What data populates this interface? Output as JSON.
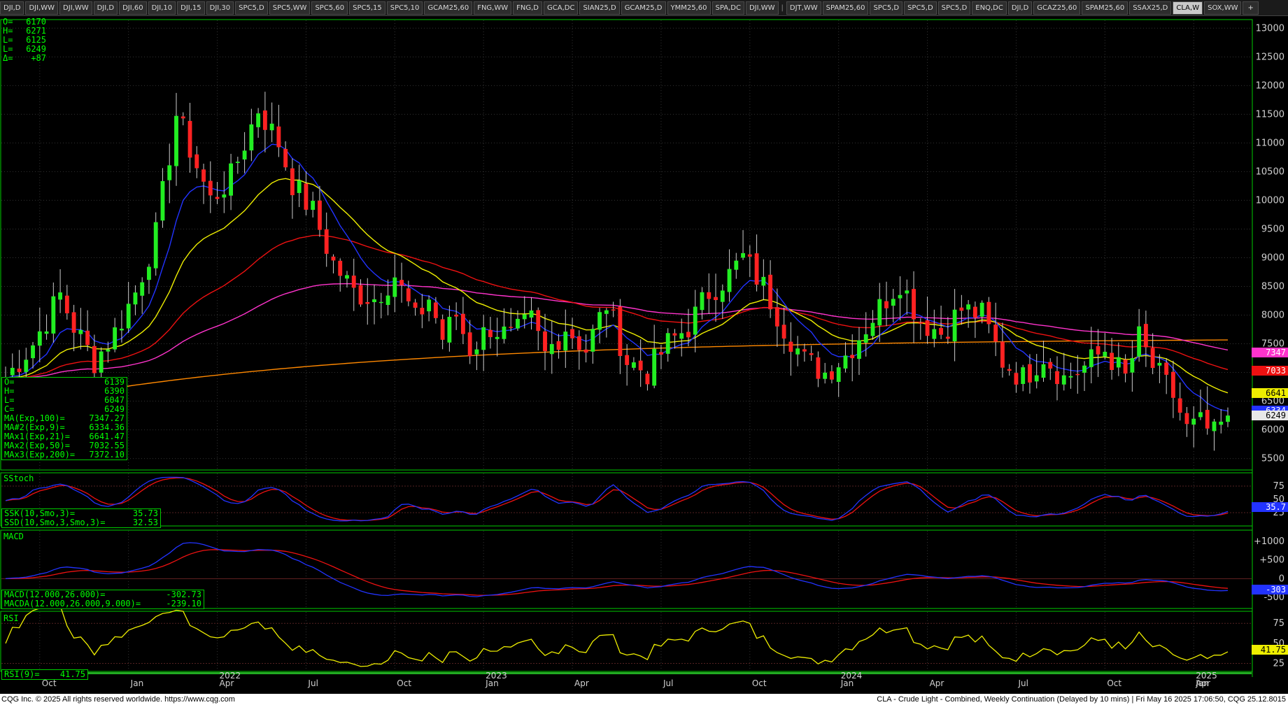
{
  "tabs": [
    "DJI,D",
    "DJI,WW",
    "DJI,WW",
    "DJI,D",
    "DJI,60",
    "DJI,10",
    "DJI,15",
    "DJI,30",
    "SPC5,D",
    "SPC5,WW",
    "SPC5,60",
    "SPC5,15",
    "SPC5,10",
    "GCAM25,60",
    "FNG,WW",
    "FNG,D",
    "GCA,DC",
    "SIAN25,D",
    "GCAM25,D",
    "YMM25,60",
    "SPA,DC",
    "DJI,WW",
    "|",
    "DJT,WW",
    "SPAM25,60",
    "SPC5,D",
    "SPC5,D",
    "SPC5,D",
    "ENQ,DC",
    "DJI,D",
    "GCAZ25,60",
    "SPAM25,60",
    "SSAX25,D",
    "CLA,W",
    "SOX,WW",
    "+"
  ],
  "active_tab": "CLA,W",
  "cursor_ohlc": [
    {
      "k": "O=",
      "v": "6170"
    },
    {
      "k": "H=",
      "v": "6271"
    },
    {
      "k": "L=",
      "v": "6125"
    },
    {
      "k": "L=",
      "v": "6249"
    },
    {
      "k": "Δ=",
      "v": "+87"
    }
  ],
  "price_info": [
    {
      "k": "O=",
      "v": "6139"
    },
    {
      "k": "H=",
      "v": "6390"
    },
    {
      "k": "L=",
      "v": "6047"
    },
    {
      "k": "C=",
      "v": "6249"
    },
    {
      "k": "MA(Exp,100)=",
      "v": "7347.27"
    },
    {
      "k": "MA#2(Exp,9)=",
      "v": "6334.36"
    },
    {
      "k": "MAx1(Exp,21)=",
      "v": "6641.47"
    },
    {
      "k": "MAx2(Exp,50)=",
      "v": "7032.55"
    },
    {
      "k": "MAx3(Exp,200)=",
      "v": "7372.10"
    }
  ],
  "sstoch": {
    "label": "SStoch",
    "info": [
      {
        "k": "SSK(10,Smo,3)=",
        "v": "35.73"
      },
      {
        "k": "SSD(10,Smo,3,Smo,3)=",
        "v": "32.53"
      }
    ],
    "axis": [
      "75",
      "50",
      "25"
    ],
    "tag": "35.7"
  },
  "macd": {
    "label": "MACD",
    "info": [
      {
        "k": "MACD(12.000,26.000)=",
        "v": "-302.73"
      },
      {
        "k": "MACDA(12.000,26.000,9.000)=",
        "v": "-239.10"
      }
    ],
    "axis": [
      "+1000",
      "+500",
      "0",
      "-500"
    ],
    "tag": "-303"
  },
  "rsi": {
    "label": "RSI",
    "info": {
      "k": "RSI(9)=",
      "v": "41.75"
    },
    "axis": [
      "75",
      "50",
      "25"
    ],
    "tag": "41.75"
  },
  "price_axis": [
    "13000",
    "12500",
    "12000",
    "11500",
    "11000",
    "10500",
    "10000",
    "9500",
    "9000",
    "8500",
    "8000",
    "7500",
    "7000",
    "6500",
    "6000",
    "5500"
  ],
  "price_tags": [
    {
      "text": "7347",
      "bg": "#ff33cc",
      "fg": "#ffffff",
      "value": 7347
    },
    {
      "text": "7033",
      "bg": "#ee1111",
      "fg": "#ffffff",
      "value": 7033
    },
    {
      "text": "6641",
      "bg": "#eeee00",
      "fg": "#000000",
      "value": 6641
    },
    {
      "text": "6334",
      "bg": "#2233ff",
      "fg": "#ffffff",
      "value": 6334
    },
    {
      "text": "6249",
      "bg": "#e8e8e8",
      "fg": "#000000",
      "value": 6249
    }
  ],
  "date_axis": [
    {
      "label": "Oct",
      "year": false
    },
    {
      "label": "Jan",
      "year": false
    },
    {
      "label": "2022",
      "year": true
    },
    {
      "label": "Apr",
      "year": false
    },
    {
      "label": "Jul",
      "year": false
    },
    {
      "label": "Oct",
      "year": false
    },
    {
      "label": "2023",
      "year": true
    },
    {
      "label": "Jan",
      "year": false
    },
    {
      "label": "Apr",
      "year": false
    },
    {
      "label": "Jul",
      "year": false
    },
    {
      "label": "Oct",
      "year": false
    },
    {
      "label": "2024",
      "year": true
    },
    {
      "label": "Jan",
      "year": false
    },
    {
      "label": "Apr",
      "year": false
    },
    {
      "label": "Jul",
      "year": false
    },
    {
      "label": "Oct",
      "year": false
    },
    {
      "label": "2025",
      "year": true
    },
    {
      "label": "Jan",
      "year": false
    },
    {
      "label": "Apr",
      "year": false
    }
  ],
  "colors": {
    "up": "#22ee22",
    "down": "#ff2222",
    "ema9": "#2233ff",
    "ema21": "#eeee00",
    "ema50": "#ee1111",
    "ema100": "#ff33cc",
    "ema200": "#ff8800",
    "grid": "#333333",
    "panel_border": "#00cc00"
  },
  "footer": {
    "left": "CQG Inc. © 2025 All rights reserved worldwide. https://www.cqg.com",
    "right": "CLA - Crude Light - Combined, Weekly Continuation (Delayed by 10 mins) | Fri May 16 2025 17:06:50, CQG 25.12.8015"
  },
  "chart_data": {
    "type": "candlestick",
    "title": "CLA - Crude Light - Combined, Weekly Continuation",
    "price_range": [
      5300,
      13150
    ],
    "anchors": [
      [
        0,
        6900
      ],
      [
        4,
        7500
      ],
      [
        8,
        8350
      ],
      [
        10,
        7800
      ],
      [
        13,
        7200
      ],
      [
        16,
        7700
      ],
      [
        19,
        8400
      ],
      [
        22,
        9400
      ],
      [
        25,
        11500
      ],
      [
        27,
        10900
      ],
      [
        30,
        10000
      ],
      [
        33,
        10400
      ],
      [
        37,
        11600
      ],
      [
        40,
        11000
      ],
      [
        42,
        10300
      ],
      [
        45,
        9800
      ],
      [
        48,
        8900
      ],
      [
        51,
        8400
      ],
      [
        54,
        8300
      ],
      [
        57,
        8700
      ],
      [
        60,
        7900
      ],
      [
        62,
        8300
      ],
      [
        64,
        7600
      ],
      [
        66,
        8000
      ],
      [
        68,
        7400
      ],
      [
        71,
        7800
      ],
      [
        74,
        7600
      ],
      [
        77,
        7900
      ],
      [
        79,
        7300
      ],
      [
        82,
        7800
      ],
      [
        85,
        7400
      ],
      [
        88,
        8200
      ],
      [
        91,
        7200
      ],
      [
        94,
        7000
      ],
      [
        97,
        7500
      ],
      [
        100,
        7800
      ],
      [
        103,
        8400
      ],
      [
        106,
        8700
      ],
      [
        108,
        9000
      ],
      [
        111,
        8500
      ],
      [
        114,
        7800
      ],
      [
        117,
        7200
      ],
      [
        120,
        7000
      ],
      [
        123,
        7300
      ],
      [
        126,
        7800
      ],
      [
        129,
        8300
      ],
      [
        131,
        8600
      ],
      [
        134,
        7900
      ],
      [
        137,
        7700
      ],
      [
        140,
        8100
      ],
      [
        143,
        8000
      ],
      [
        146,
        7200
      ],
      [
        149,
        6900
      ],
      [
        152,
        7300
      ],
      [
        155,
        6900
      ],
      [
        158,
        7100
      ],
      [
        161,
        7400
      ],
      [
        164,
        6900
      ],
      [
        166,
        7600
      ],
      [
        168,
        7100
      ],
      [
        171,
        6600
      ],
      [
        173,
        6000
      ],
      [
        175,
        6100
      ],
      [
        177,
        5900
      ],
      [
        179,
        6250
      ]
    ],
    "sstoch_range": [
      0,
      100
    ],
    "macd_range": [
      -800,
      1300
    ],
    "rsi_range": [
      15,
      90
    ]
  }
}
